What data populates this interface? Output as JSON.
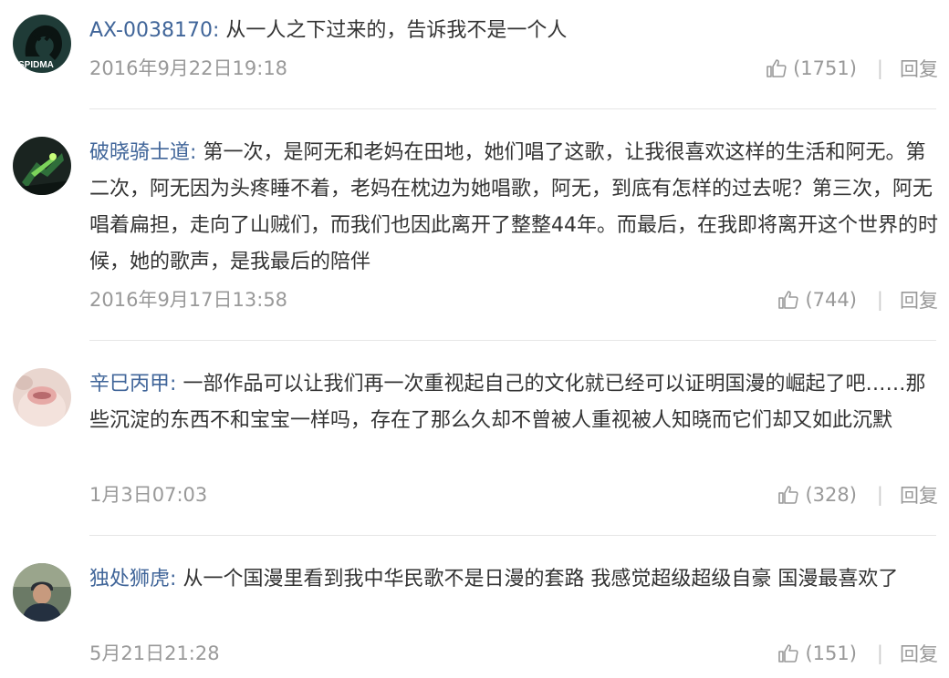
{
  "comments": [
    {
      "user": "AX-0038170",
      "separator": ":",
      "text": "从一人之下过来的，告诉我不是一个人",
      "time": "2016年9月22日19:18",
      "likes": "(1751)",
      "pipe": "|",
      "reply_label": "回复",
      "avatar_text": "SPIDMA",
      "avatar_icon": "avatar-dark-icon"
    },
    {
      "user": "破晓骑士道",
      "separator": ":",
      "text": "第一次，是阿无和老妈在田地，她们唱了这歌，让我很喜欢这样的生活和阿无。第二次，阿无因为头疼睡不着，老妈在枕边为她唱歌，阿无，到底有怎样的过去呢？第三次，阿无唱着扁担，走向了山贼们，而我们也因此离开了整整44年。而最后，在我即将离开这个世界的时候，她的歌声，是我最后的陪伴",
      "time": "2016年9月17日13:58",
      "likes": "(744)",
      "pipe": "|",
      "reply_label": "回复",
      "avatar_icon": "avatar-anime-icon"
    },
    {
      "user": "辛巳丙甲",
      "separator": ":",
      "text": "一部作品可以让我们再一次重视起自己的文化就已经可以证明国漫的崛起了吧……那些沉淀的东西不和宝宝一样吗，存在了那么久却不曾被人重视被人知晓而它们却又如此沉默",
      "time": "1月3日07:03",
      "likes": "(328)",
      "pipe": "|",
      "reply_label": "回复",
      "avatar_icon": "avatar-face-icon"
    },
    {
      "user": "独处狮虎",
      "separator": ":",
      "text": "从一个国漫里看到我中华民歌不是日漫的套路 我感觉超级超级自豪 国漫最喜欢了",
      "time": "5月21日21:28",
      "likes": "(151)",
      "pipe": "|",
      "reply_label": "回复",
      "avatar_icon": "avatar-person-icon"
    }
  ],
  "colors": {
    "username": "#406599",
    "text": "#333333",
    "meta": "#999999",
    "divider": "#e6e6e6"
  },
  "icons": {
    "like": "thumbs-up-icon"
  }
}
